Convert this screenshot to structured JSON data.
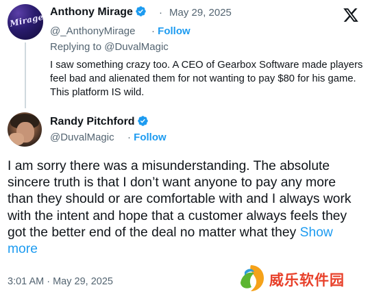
{
  "reply_tweet": {
    "author_name": "Anthony Mirage",
    "avatar_text": "Mirage",
    "dot": "·",
    "date": "May 29, 2025",
    "handle": "@_AnthonyMirage",
    "separator": "·",
    "follow_label": "Follow",
    "replying_prefix": "Replying to",
    "replying_to": "@DuvalMagic",
    "text": "I saw something crazy too. A CEO of Gearbox Software made players feel bad and alienated them for not wanting to pay $80 for his game. This platform IS wild."
  },
  "main_tweet": {
    "author_name": "Randy Pitchford",
    "handle": "@DuvalMagic",
    "separator": "·",
    "follow_label": "Follow",
    "text": "I am sorry there was a misunderstanding. The absolute sincere truth is that I don’t want anyone to pay any more than they should or are comfortable with and I always work with the intent and hope that a customer always feels they got the better end of the deal no matter what they",
    "show_more_label": "Show more",
    "timestamp": "3:01 AM · May 29, 2025"
  },
  "watermark": {
    "text": "威乐软件园"
  },
  "colors": {
    "accent": "#1d9bf0",
    "secondary_text": "#536471",
    "primary_text": "#0f1419",
    "watermark": "#e8402a"
  },
  "icons": {
    "verified": "verified-badge-icon",
    "brand": "x-logo-icon"
  }
}
